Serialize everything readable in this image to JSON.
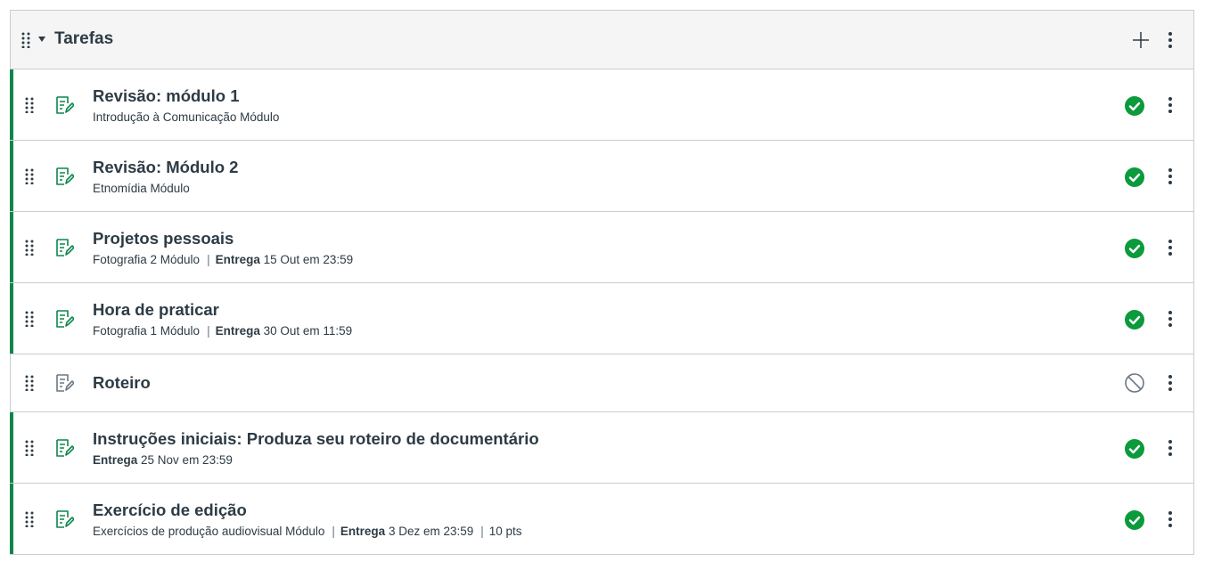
{
  "module": {
    "title": "Tarefas",
    "add_icon": "plus-icon",
    "menu_icon": "kebab-icon",
    "colors": {
      "published": "#0b874b",
      "text": "#2d3b45",
      "unpublished_icon": "#6b7780"
    }
  },
  "items": [
    {
      "title": "Revisão: módulo 1",
      "module": "Introdução à Comunicação Módulo",
      "due_label": "",
      "due_date": "",
      "points": "",
      "published": true
    },
    {
      "title": "Revisão: Módulo 2",
      "module": "Etnomídia Módulo",
      "due_label": "",
      "due_date": "",
      "points": "",
      "published": true
    },
    {
      "title": "Projetos pessoais",
      "module": "Fotografia 2 Módulo",
      "due_label": "Entrega",
      "due_date": "15 Out em 23:59",
      "points": "",
      "published": true
    },
    {
      "title": "Hora de praticar",
      "module": "Fotografia 1 Módulo",
      "due_label": "Entrega",
      "due_date": "30 Out em 11:59",
      "points": "",
      "published": true
    },
    {
      "title": "Roteiro",
      "module": "",
      "due_label": "",
      "due_date": "",
      "points": "",
      "published": false
    },
    {
      "title": "Instruções iniciais: Produza seu roteiro de documentário",
      "module": "",
      "due_label": "Entrega",
      "due_date": "25 Nov em 23:59",
      "points": "",
      "published": true
    },
    {
      "title": "Exercício de edição",
      "module": "Exercícios de produção audiovisual Módulo",
      "due_label": "Entrega",
      "due_date": "3 Dez em 23:59",
      "points": "10 pts",
      "published": true
    }
  ]
}
